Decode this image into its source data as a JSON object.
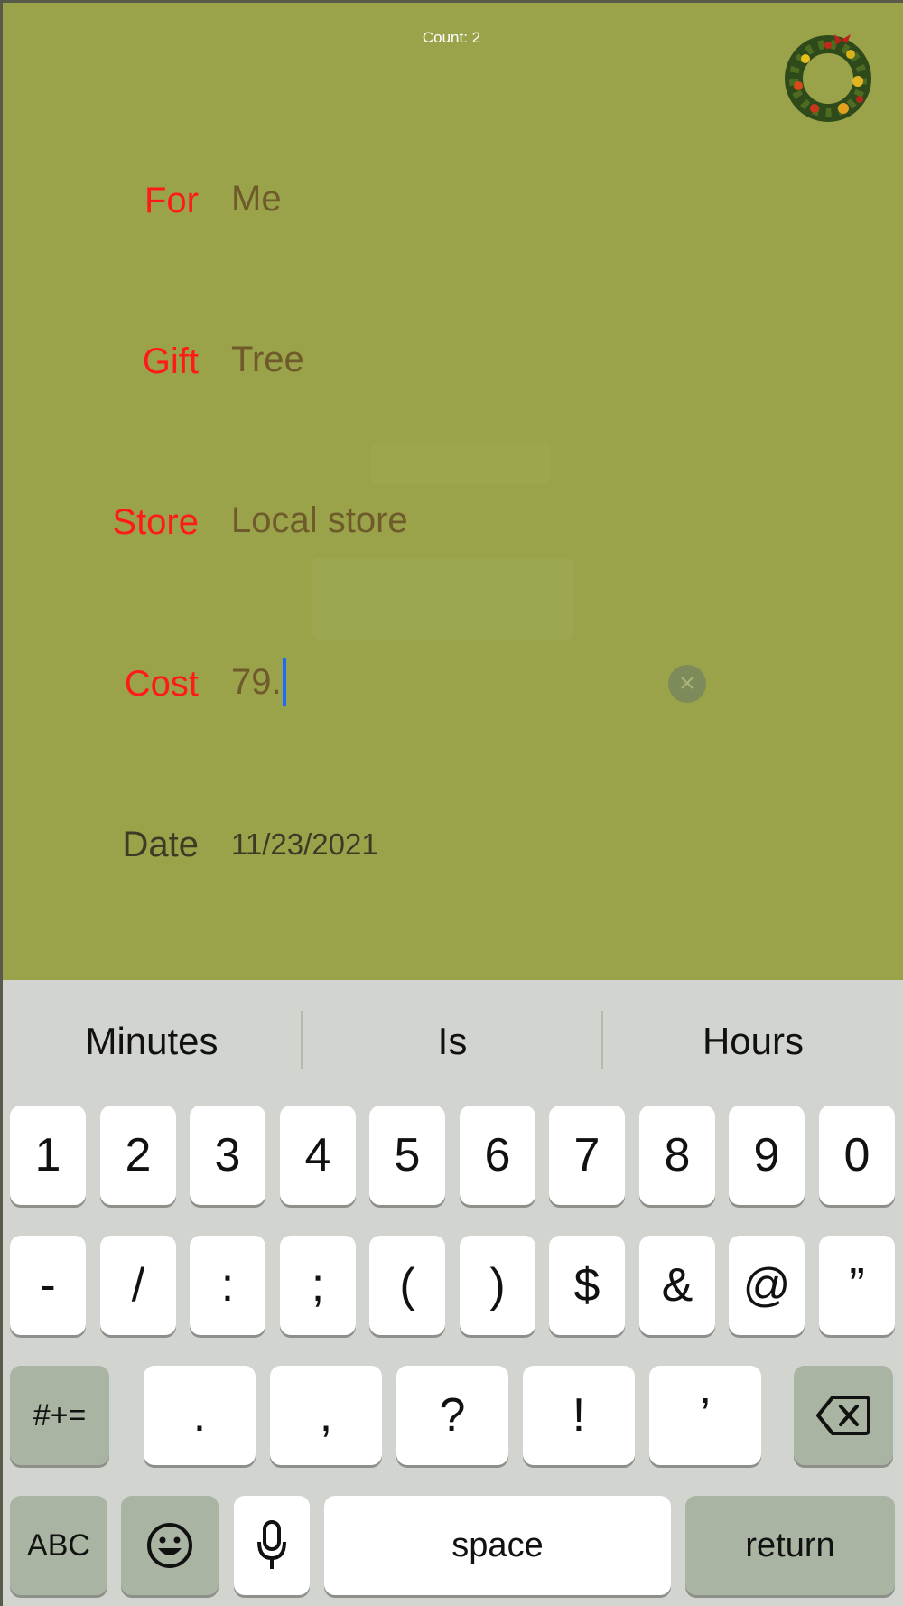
{
  "header": {
    "count_label": "Count: 2",
    "wreath_icon": "christmas-wreath-icon"
  },
  "form": {
    "for": {
      "label": "For",
      "value": "Me"
    },
    "gift": {
      "label": "Gift",
      "value": "Tree"
    },
    "store": {
      "label": "Store",
      "value": "Local store"
    },
    "cost": {
      "label": "Cost",
      "value": "79."
    },
    "date": {
      "label": "Date",
      "value": "11/23/2021"
    }
  },
  "colors": {
    "background": "#9aa34a",
    "label_red": "#ff1a1a",
    "value_brown": "#6e5a2a",
    "caret": "#1a6bff"
  },
  "keyboard": {
    "suggestions": [
      "Minutes",
      "Is",
      "Hours"
    ],
    "row1": [
      "1",
      "2",
      "3",
      "4",
      "5",
      "6",
      "7",
      "8",
      "9",
      "0"
    ],
    "row2": [
      "-",
      "/",
      ":",
      ";",
      "(",
      ")",
      "$",
      "&",
      "@",
      "”"
    ],
    "row3": [
      ".",
      ",",
      "?",
      "!",
      "’"
    ],
    "more_symbols": "#+=",
    "abc": "ABC",
    "space": "space",
    "return": "return"
  }
}
